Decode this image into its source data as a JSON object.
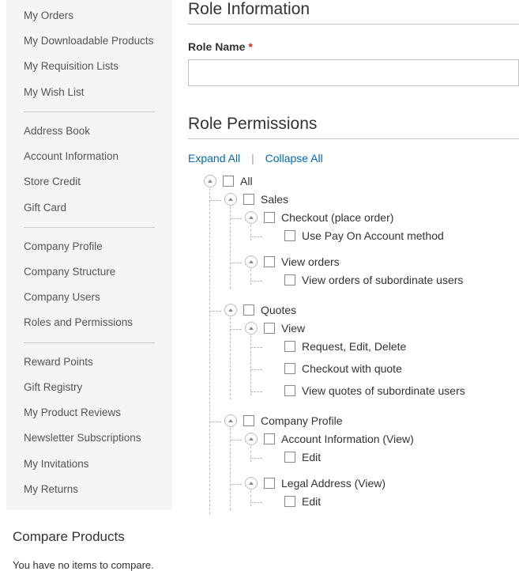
{
  "sidebar": {
    "groups": [
      {
        "items": [
          {
            "label": "My Orders"
          },
          {
            "label": "My Downloadable Products"
          },
          {
            "label": "My Requisition Lists"
          },
          {
            "label": "My Wish List"
          }
        ]
      },
      {
        "items": [
          {
            "label": "Address Book"
          },
          {
            "label": "Account Information"
          },
          {
            "label": "Store Credit"
          },
          {
            "label": "Gift Card"
          }
        ]
      },
      {
        "items": [
          {
            "label": "Company Profile"
          },
          {
            "label": "Company Structure"
          },
          {
            "label": "Company Users"
          },
          {
            "label": "Roles and Permissions"
          }
        ]
      },
      {
        "items": [
          {
            "label": "Reward Points"
          },
          {
            "label": "Gift Registry"
          },
          {
            "label": "My Product Reviews"
          },
          {
            "label": "Newsletter Subscriptions"
          },
          {
            "label": "My Invitations"
          },
          {
            "label": "My Returns"
          }
        ]
      }
    ]
  },
  "compare": {
    "title": "Compare Products",
    "empty": "You have no items to compare."
  },
  "info": {
    "heading": "Role Information",
    "role_name_label": "Role Name",
    "required": "*",
    "role_name_value": ""
  },
  "perms": {
    "heading": "Role Permissions",
    "expand_all": "Expand All",
    "collapse_all": "Collapse All",
    "sep": "|"
  },
  "tree": {
    "label": "All",
    "expandable": true,
    "children": [
      {
        "label": "Sales",
        "expandable": true,
        "children": [
          {
            "label": "Checkout (place order)",
            "expandable": true,
            "children": [
              {
                "label": "Use Pay On Account method",
                "expandable": false
              }
            ]
          },
          {
            "label": "View orders",
            "expandable": true,
            "children": [
              {
                "label": "View orders of subordinate users",
                "expandable": false
              }
            ]
          }
        ]
      },
      {
        "label": "Quotes",
        "expandable": true,
        "children": [
          {
            "label": "View",
            "expandable": true,
            "children": [
              {
                "label": "Request, Edit, Delete",
                "expandable": false
              },
              {
                "label": "Checkout with quote",
                "expandable": false
              },
              {
                "label": "View quotes of subordinate users",
                "expandable": false
              }
            ]
          }
        ]
      },
      {
        "label": "Company Profile",
        "expandable": true,
        "children": [
          {
            "label": "Account Information (View)",
            "expandable": true,
            "children": [
              {
                "label": "Edit",
                "expandable": false
              }
            ]
          },
          {
            "label": "Legal Address (View)",
            "expandable": true,
            "children": [
              {
                "label": "Edit",
                "expandable": false
              }
            ]
          }
        ]
      }
    ]
  }
}
